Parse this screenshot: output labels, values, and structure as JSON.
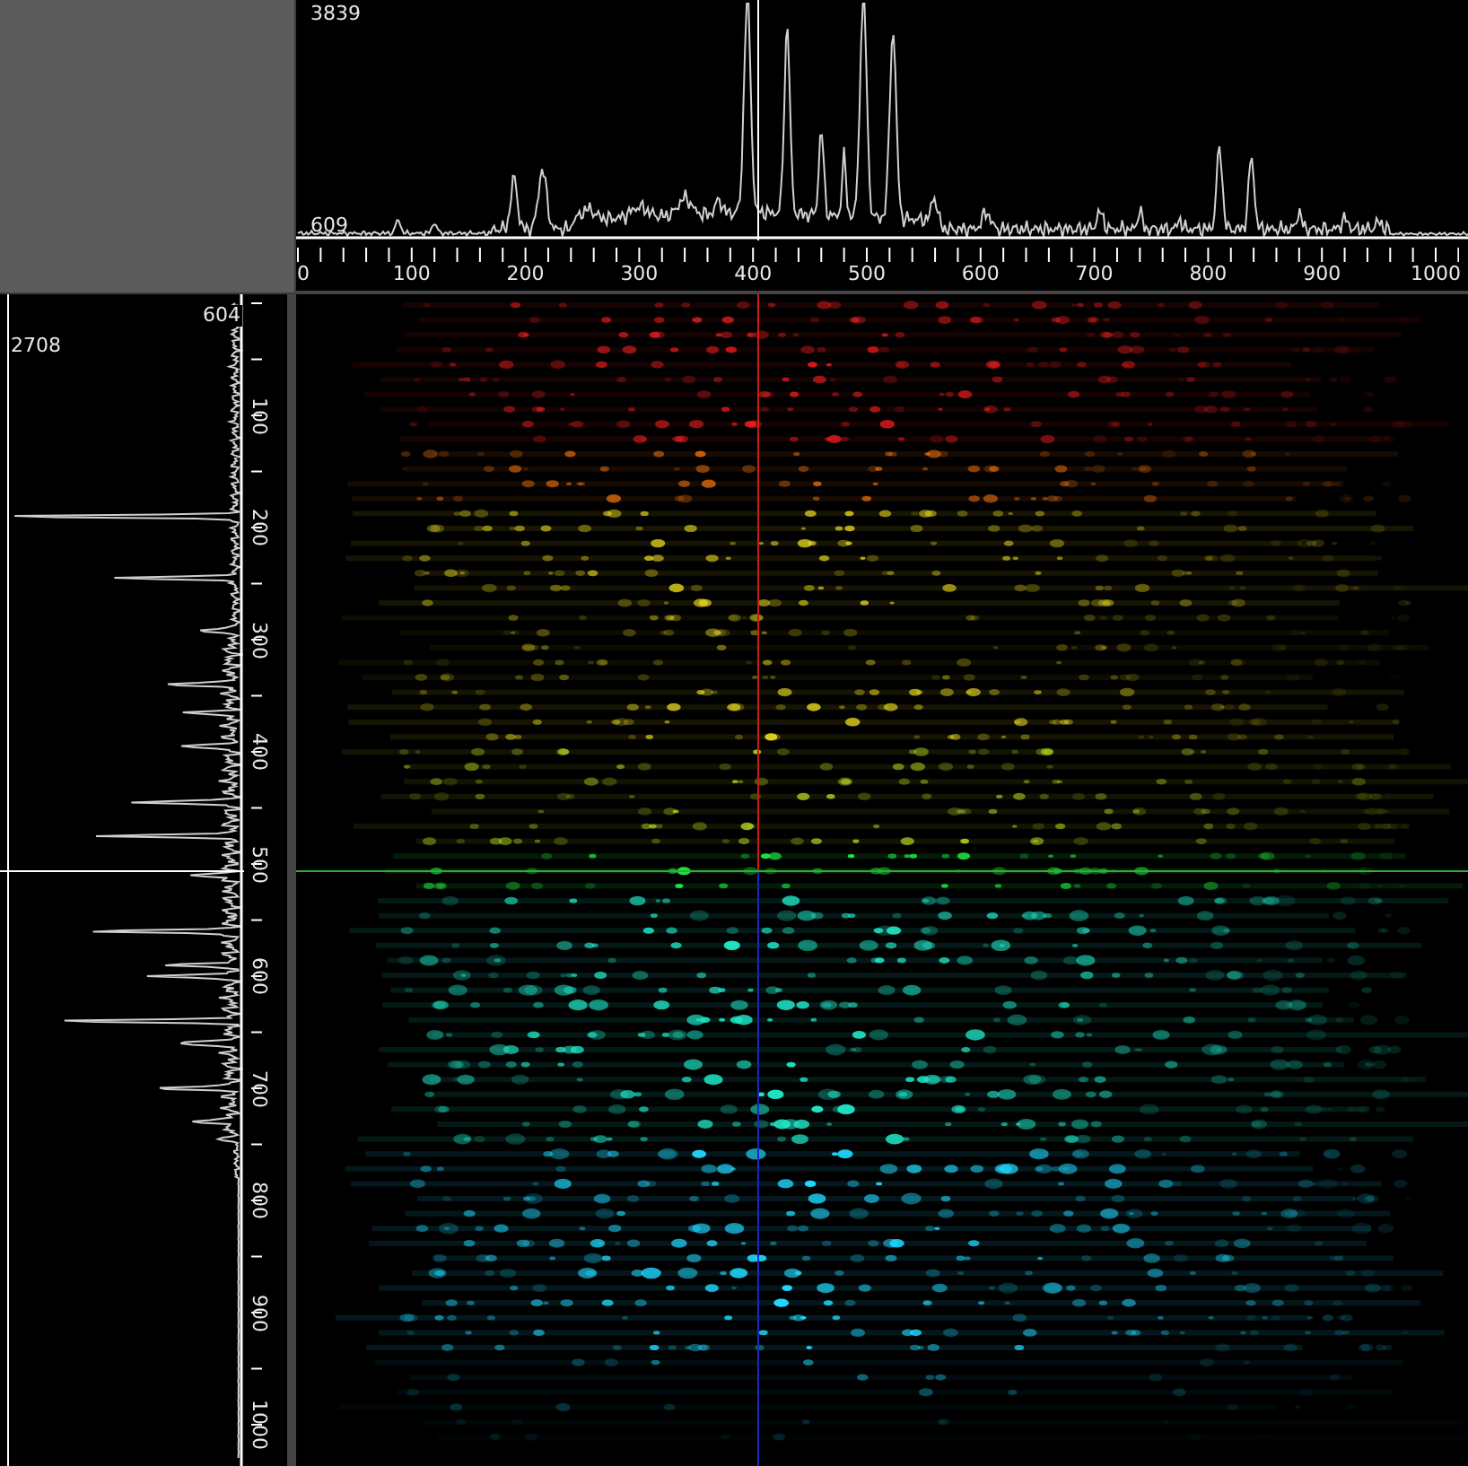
{
  "top_profile": {
    "max_label": "3839",
    "min_label": "609",
    "axis_ticks": [
      "0",
      "100",
      "200",
      "300",
      "400",
      "500",
      "600",
      "700",
      "800",
      "900",
      "1000"
    ]
  },
  "side_profile": {
    "max_label": "2708",
    "min_label": "604",
    "axis_ticks": [
      "100",
      "200",
      "300",
      "400",
      "500",
      "600",
      "700",
      "800",
      "900",
      "1000"
    ]
  }
}
